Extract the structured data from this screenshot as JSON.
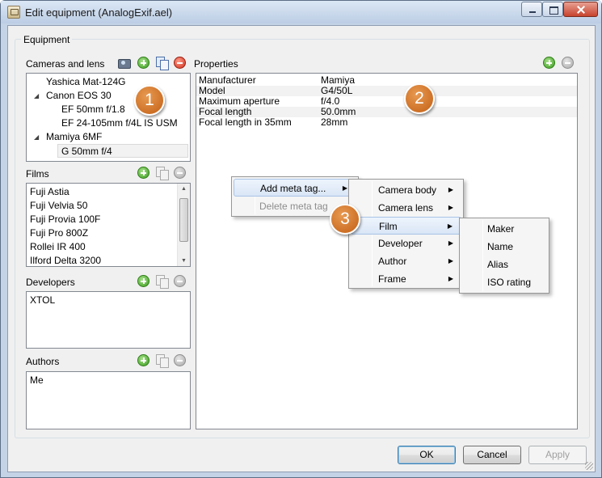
{
  "window": {
    "title": "Edit equipment (AnalogExif.ael)"
  },
  "group_title": "Equipment",
  "cameras": {
    "label": "Cameras and lens",
    "items": [
      "Yashica Mat-124G",
      "Canon EOS 30",
      "EF 50mm f/1.8",
      "EF 24-105mm f/4L IS USM",
      "Mamiya 6MF",
      "G 50mm f/4"
    ],
    "selected": "G 50mm f/4"
  },
  "films": {
    "label": "Films",
    "items": [
      "Fuji Astia",
      "Fuji Velvia 50",
      "Fuji Provia 100F",
      "Fuji Pro 800Z",
      "Rollei IR 400",
      "Ilford Delta 3200"
    ]
  },
  "developers": {
    "label": "Developers",
    "items": [
      "XTOL"
    ]
  },
  "authors": {
    "label": "Authors",
    "items": [
      "Me"
    ]
  },
  "properties": {
    "label": "Properties",
    "rows": [
      {
        "key": "Manufacturer",
        "value": "Mamiya"
      },
      {
        "key": "Model",
        "value": "G4/50L"
      },
      {
        "key": "Maximum aperture",
        "value": "f/4.0"
      },
      {
        "key": "Focal length",
        "value": "50.0mm"
      },
      {
        "key": "Focal length in 35mm",
        "value": "28mm"
      }
    ]
  },
  "badges": [
    "1",
    "2",
    "3"
  ],
  "context_menu": {
    "add": "Add meta tag...",
    "delete": "Delete meta tag"
  },
  "submenu": [
    "Camera body",
    "Camera lens",
    "Film",
    "Developer",
    "Author",
    "Frame"
  ],
  "film_submenu": [
    "Maker",
    "Name",
    "Alias",
    "ISO rating"
  ],
  "buttons": {
    "ok": "OK",
    "cancel": "Cancel",
    "apply": "Apply"
  }
}
